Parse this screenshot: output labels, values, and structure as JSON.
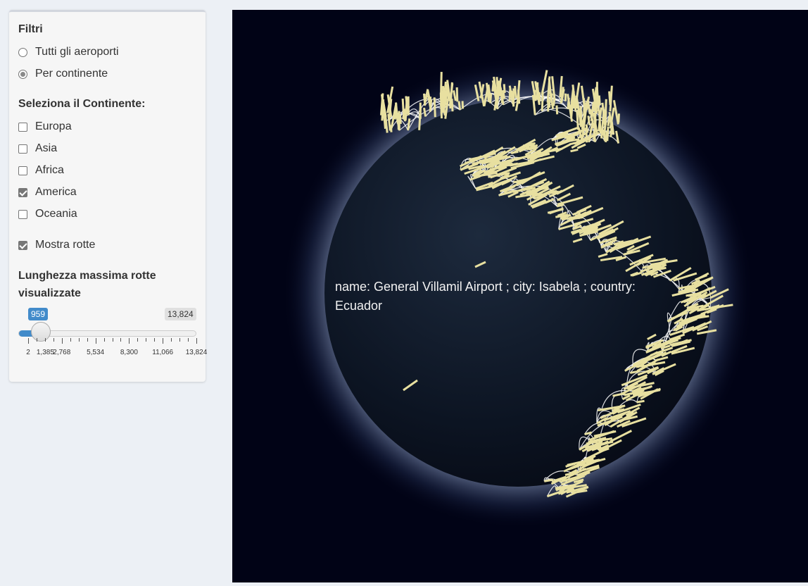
{
  "filters": {
    "title": "Filtri",
    "scope_options": [
      {
        "label": "Tutti gli aeroporti",
        "selected": false
      },
      {
        "label": "Per continente",
        "selected": true
      }
    ],
    "continent_title": "Seleziona il Continente:",
    "continents": [
      {
        "label": "Europa",
        "checked": false
      },
      {
        "label": "Asia",
        "checked": false
      },
      {
        "label": "Africa",
        "checked": false
      },
      {
        "label": "America",
        "checked": true
      },
      {
        "label": "Oceania",
        "checked": false
      }
    ],
    "show_routes": {
      "label": "Mostra rotte",
      "checked": true
    },
    "slider": {
      "title_line1": "Lunghezza massima rotte",
      "title_line2": "visualizzate",
      "min": 2,
      "max": 13824,
      "value": 959,
      "value_label": "959",
      "max_label": "13,824",
      "tick_labels": [
        "2",
        "1,385",
        "2,768",
        "5,534",
        "8,300",
        "11,066",
        "13,824"
      ]
    }
  },
  "globe": {
    "tooltip_line1": "name: General Villamil Airport ; city: Isabela ; country:",
    "tooltip_line2": "Ecuador",
    "bar_color": "#e8e0a0",
    "route_color": "#ffffff",
    "background": "#010316"
  }
}
